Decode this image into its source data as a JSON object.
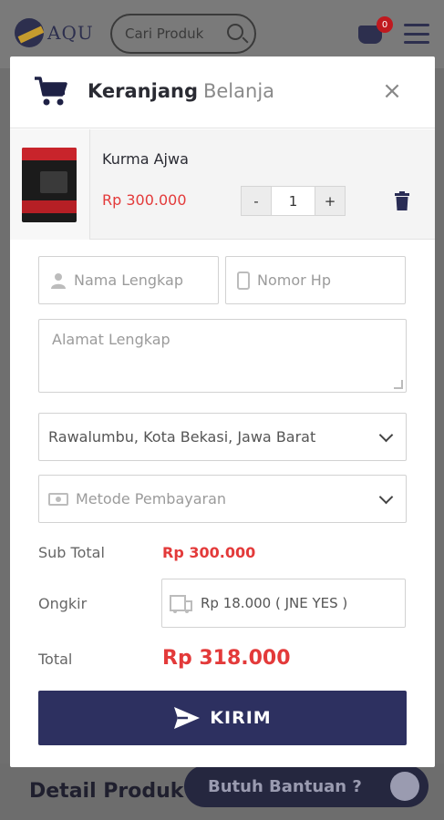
{
  "background": {
    "logo_text": "AQU",
    "search_placeholder": "Cari Produk",
    "cart_count": "0",
    "detail_title": "Detail Produk",
    "help_label": "Butuh Bantuan ?"
  },
  "modal": {
    "title_strong": "Keranjang",
    "title_light": "Belanja",
    "close_label": "×"
  },
  "item": {
    "name": "Kurma Ajwa",
    "price": "Rp 300.000",
    "quantity": "1",
    "minus_label": "-",
    "plus_label": "+"
  },
  "form": {
    "name_placeholder": "Nama Lengkap",
    "phone_placeholder": "Nomor Hp",
    "address_placeholder": "Alamat Lengkap",
    "city_value": "Rawalumbu, Kota Bekasi, Jawa Barat",
    "payment_placeholder": "Metode Pembayaran",
    "shipping_value": "Rp 18.000 ( JNE YES )"
  },
  "summary": {
    "subtotal_label": "Sub Total",
    "subtotal_value": "Rp 300.000",
    "shipping_label": "Ongkir",
    "total_label": "Total",
    "total_value": "Rp 318.000"
  },
  "submit_label": "KIRIM",
  "colors": {
    "accent": "#2d3060",
    "price": "#e33a3a"
  }
}
